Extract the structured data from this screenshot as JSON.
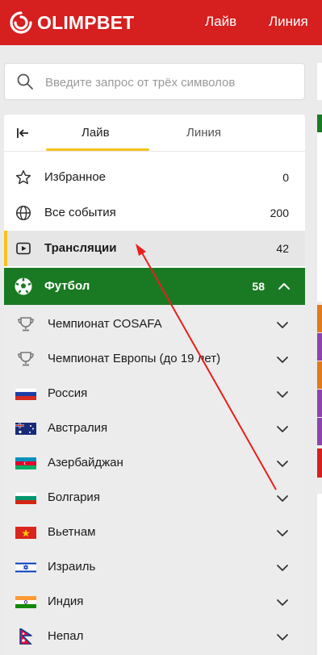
{
  "header": {
    "logo_text": "OLIMPBET",
    "nav": [
      "Лайв",
      "Линия"
    ],
    "brand_color": "#d61f1f"
  },
  "search": {
    "placeholder": "Введите запрос от трёх символов",
    "value": ""
  },
  "tabs": {
    "live": "Лайв",
    "line": "Линия",
    "active": "Лайв",
    "accent_color": "#f6c21b"
  },
  "menu": [
    {
      "label": "Избранное",
      "count": "0",
      "icon": "star-icon"
    },
    {
      "label": "Все события",
      "count": "200",
      "icon": "globe-icon"
    },
    {
      "label": "Трансляции",
      "count": "42",
      "icon": "video-icon",
      "active": true
    }
  ],
  "sport": {
    "label": "Футбол",
    "count": "58",
    "icon": "soccer-ball-icon",
    "color": "#1a7a23",
    "expanded": true
  },
  "championships": [
    {
      "label": "Чемпионат COSAFA",
      "icon": "trophy-icon"
    },
    {
      "label": "Чемпионат Европы (до 19 лет)",
      "icon": "trophy-icon"
    },
    {
      "label": "Россия",
      "icon": "flag-russia-icon"
    },
    {
      "label": "Австралия",
      "icon": "flag-australia-icon"
    },
    {
      "label": "Азербайджан",
      "icon": "flag-azerbaijan-icon"
    },
    {
      "label": "Болгария",
      "icon": "flag-bulgaria-icon"
    },
    {
      "label": "Вьетнам",
      "icon": "flag-vietnam-icon"
    },
    {
      "label": "Израиль",
      "icon": "flag-israel-icon"
    },
    {
      "label": "Индия",
      "icon": "flag-india-icon"
    },
    {
      "label": "Непал",
      "icon": "flag-nepal-icon"
    }
  ],
  "annotation": {
    "color": "#e8201c"
  }
}
